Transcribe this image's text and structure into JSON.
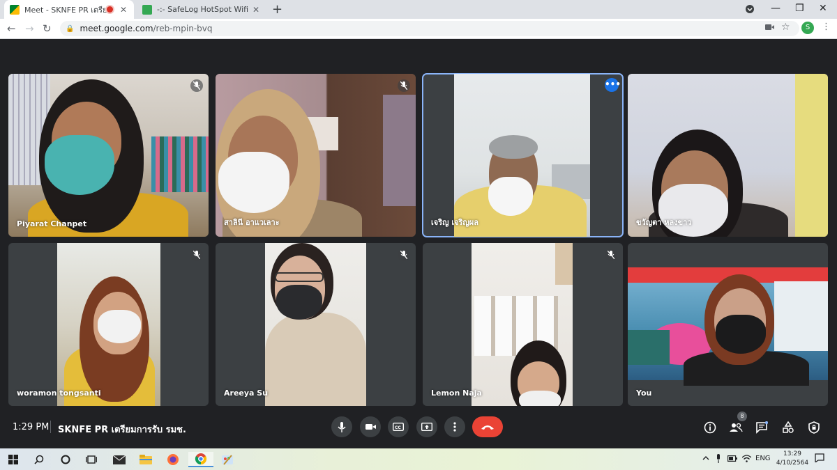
{
  "browser": {
    "tabs": [
      {
        "title": "Meet - SKNFE PR เตรียมการรับ",
        "active": true
      },
      {
        "title": "-:- SafeLog HotSpot Wifi Internet",
        "active": false
      }
    ],
    "url_host": "meet.google.com",
    "url_path": "/reb-mpin-bvq",
    "profile_initial": "S"
  },
  "participants": [
    {
      "name": "Piyarat Chanpet",
      "muted": true,
      "selected": false
    },
    {
      "name": "สาลินี อาแวเลาะ",
      "muted": true,
      "selected": false
    },
    {
      "name": "เจริญ เจริญผล",
      "muted": false,
      "selected": true
    },
    {
      "name": "ขวัญตา หลงขาว",
      "muted": false,
      "selected": false
    },
    {
      "name": "woramon tongsanti",
      "muted": true,
      "selected": false
    },
    {
      "name": "Areeya Su",
      "muted": true,
      "selected": false
    },
    {
      "name": "Lemon Naja",
      "muted": true,
      "selected": false
    },
    {
      "name": "You",
      "muted": false,
      "selected": false
    }
  ],
  "meeting": {
    "time": "1:29 PM",
    "title": "SKNFE PR เตรียมการรับ รมช.",
    "people_count": "8"
  },
  "colors": {
    "end_call": "#ea4335",
    "selected_outline": "#8ab4f8",
    "tile_bg": "#3c4043"
  },
  "taskbar": {
    "lang": "ENG",
    "time": "13:29",
    "date": "4/10/2564"
  }
}
